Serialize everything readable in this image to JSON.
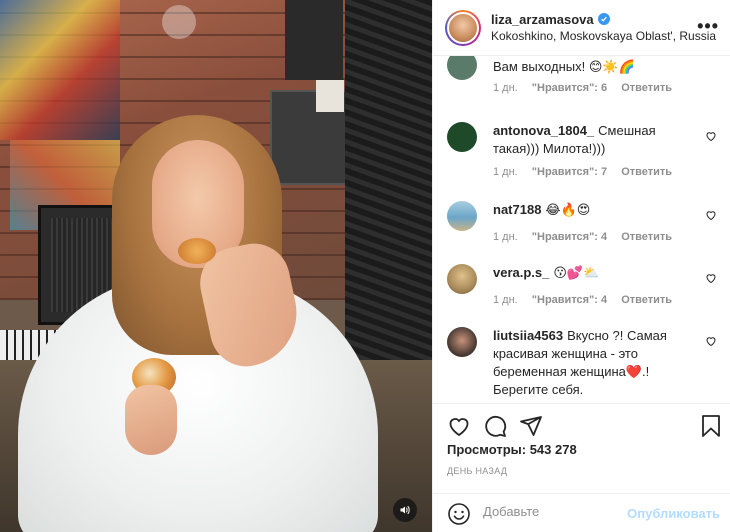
{
  "post": {
    "username": "liza_arzamasova",
    "location": "Kokoshkino, Moskovskaya Oblast', Russia",
    "more_label": "•••"
  },
  "comments": [
    {
      "username": "",
      "text": "Вам выходных! 😊☀️🌈",
      "time": "1 дн.",
      "likes": "\"Нравится\": 6",
      "reply": "Ответить",
      "avatar_color": "#5a7a6a"
    },
    {
      "username": "antonova_1804_",
      "text": "Смешная такая))) Милота!)))",
      "time": "1 дн.",
      "likes": "\"Нравится\": 7",
      "reply": "Ответить",
      "avatar_color": "#1f4a2a"
    },
    {
      "username": "nat7188",
      "text": "😂🔥😍",
      "time": "1 дн.",
      "likes": "\"Нравится\": 4",
      "reply": "Ответить",
      "avatar_color": "#6aa6c8"
    },
    {
      "username": "vera.p.s_",
      "text": "😗💕⛅",
      "time": "1 дн.",
      "likes": "\"Нравится\": 4",
      "reply": "Ответить",
      "avatar_color": "#a88a5a"
    },
    {
      "username": "liutsiia4563",
      "text": "Вкусно ?! Самая красивая женщина - это беременная женщина❤️.! Берегите себя.",
      "time": "",
      "likes": "",
      "reply": "",
      "avatar_color": "#4a3a34"
    }
  ],
  "stats": {
    "views": "Просмотры: 543 278",
    "date": "ДЕНЬ НАЗАД"
  },
  "add_comment": {
    "placeholder": "Добавьте комментарий...",
    "visible_placeholder": "Добавьте",
    "publish_label": "Опубликовать"
  },
  "colors": {
    "accent_blue": "#3897f0",
    "publish_disabled": "#b3dbff",
    "meta_gray": "#8e8e8e",
    "text": "#262626"
  },
  "icons": {
    "like": "heart-icon",
    "comment": "comment-icon",
    "share": "paper-plane-icon",
    "save": "bookmark-icon",
    "sound": "speaker-icon",
    "emoji": "smiley-icon"
  }
}
